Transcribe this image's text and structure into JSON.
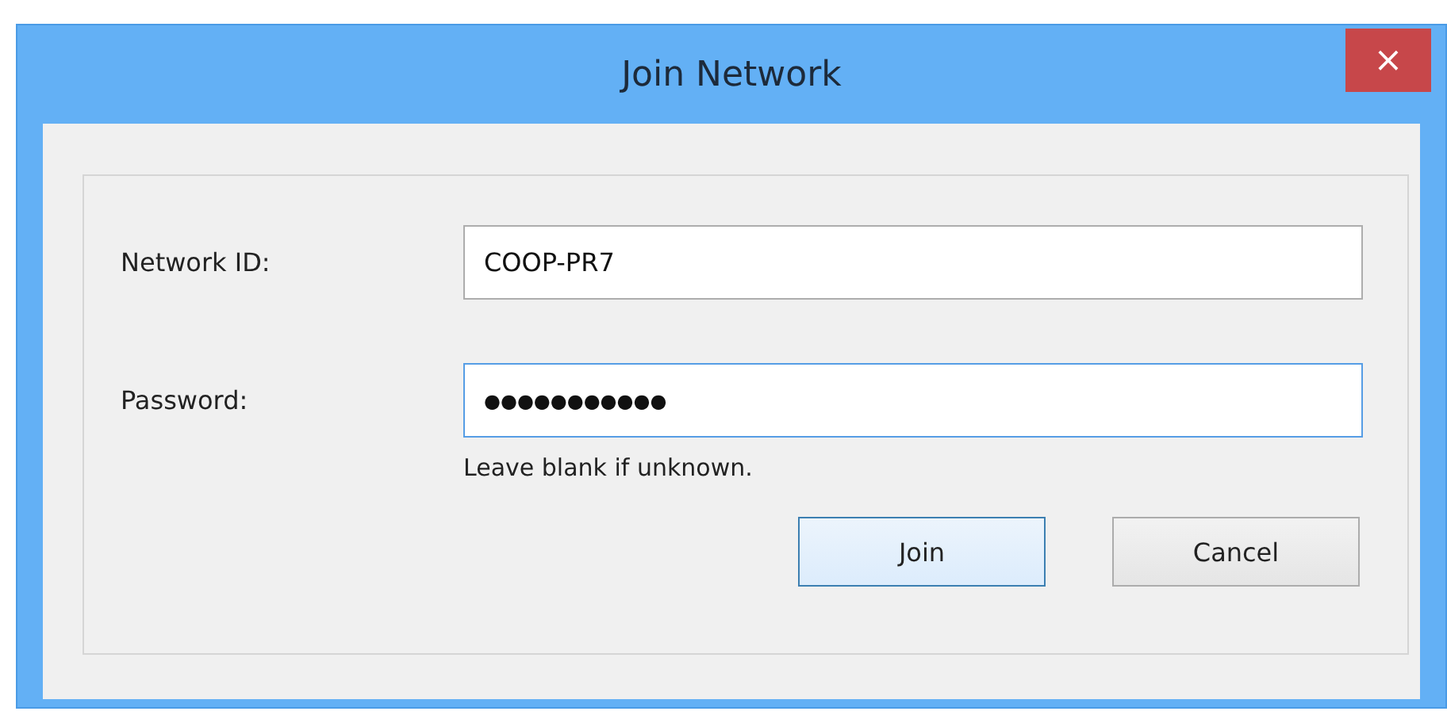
{
  "window": {
    "title": "Join Network",
    "close": "×"
  },
  "fields": [
    {
      "label": "Network ID:",
      "value": "COOP-PR7",
      "focused": false
    },
    {
      "label": "Password:",
      "value": "●●●●●●●●●●●",
      "focused": true
    }
  ],
  "hint": "Leave blank if unknown.",
  "buttons": [
    {
      "label": "Join",
      "default": true
    },
    {
      "label": "Cancel",
      "default": false
    }
  ]
}
